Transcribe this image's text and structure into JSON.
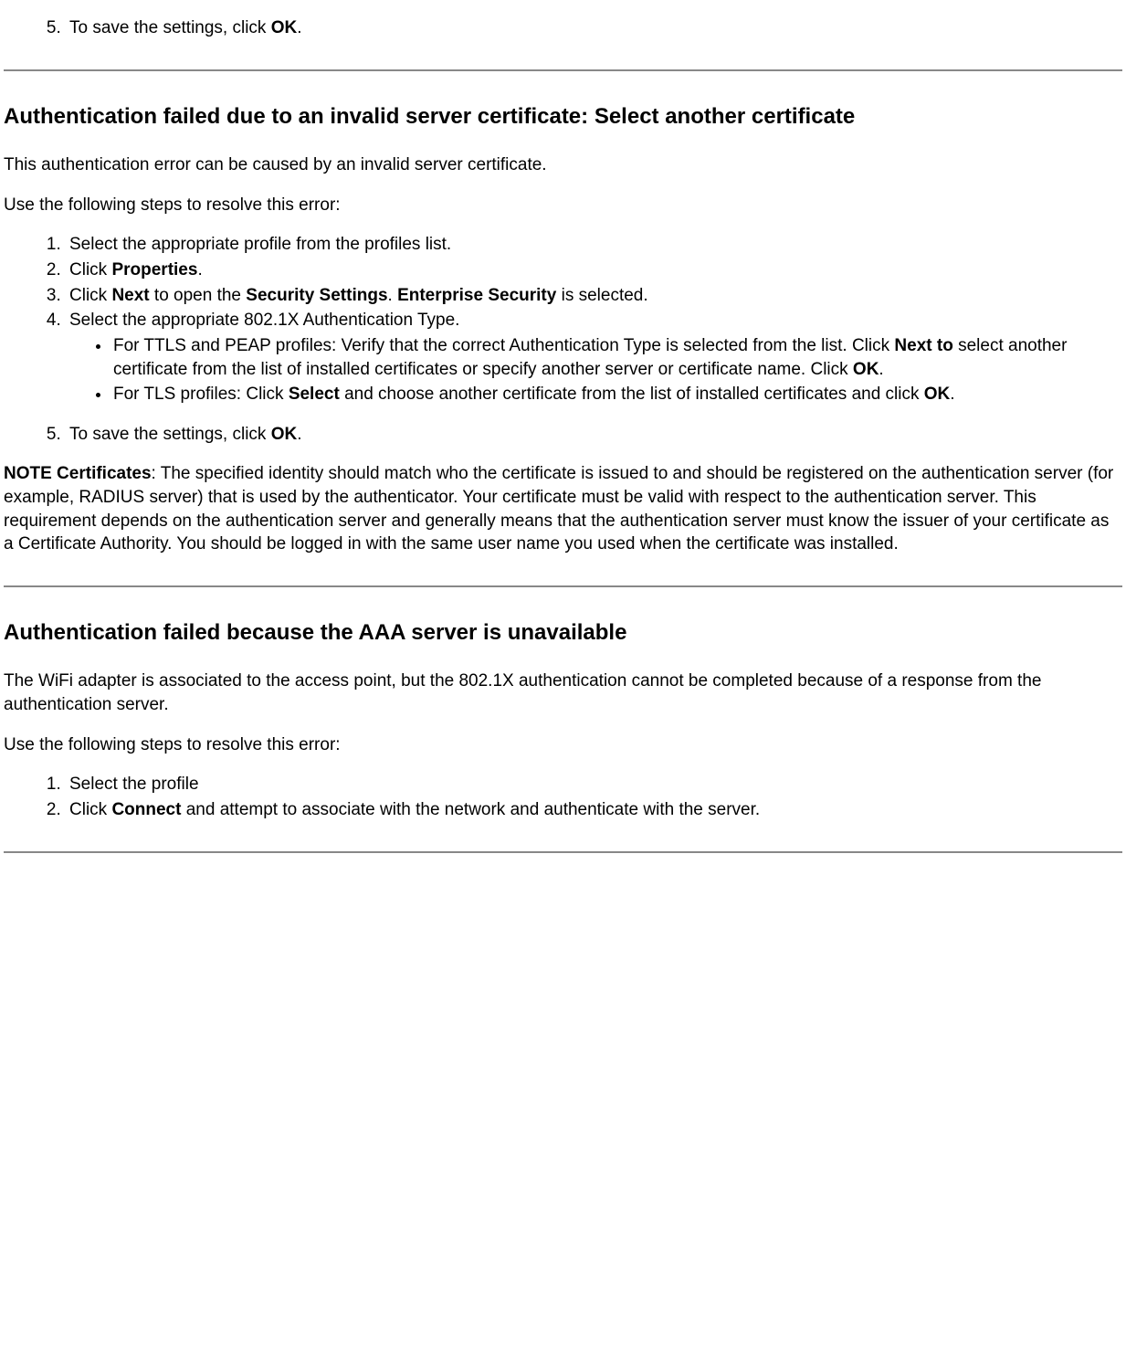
{
  "intro_step5": {
    "num": "5.",
    "pre": "To save the settings, click ",
    "b1": "OK",
    "post": "."
  },
  "sec1": {
    "heading": "Authentication failed due to an invalid server certificate: Select another certificate",
    "p1": "This authentication error can be caused by an invalid server certificate.",
    "p2": "Use the following steps to resolve this error:",
    "li1": "Select the appropriate profile from the profiles list.",
    "li2": {
      "pre": "Click ",
      "b": "Properties",
      "post": "."
    },
    "li3": {
      "t1": "Click ",
      "b1": "Next",
      "t2": " to open the ",
      "b2": "Security Settings",
      "t3": ". ",
      "b3": "Enterprise Security",
      "t4": " is selected."
    },
    "li4": "Select the appropriate 802.1X Authentication Type.",
    "sub1": {
      "t1": "For TTLS and PEAP profiles: Verify that the correct Authentication Type is selected from the list. Click ",
      "b1": "Next to",
      "t2": " select another certificate from the list of installed certificates or specify another server or certificate name. Click ",
      "b2": "OK",
      "t3": "."
    },
    "sub2": {
      "t1": "For TLS profiles: Click ",
      "b1": "Select",
      "t2": " and choose another certificate from the list of installed certificates and click ",
      "b2": "OK",
      "t3": "."
    },
    "li5": {
      "pre": "To save the settings, click ",
      "b": "OK",
      "post": "."
    },
    "note": {
      "b": "NOTE Certificates",
      "text": ": The specified identity should match who the certificate is issued to and should be registered on the authentication server (for example, RADIUS server) that is used by the authenticator. Your certificate must be valid with respect to the authentication server. This requirement depends on the authentication server and generally means that the authentication server must know the issuer of your certificate as a Certificate Authority. You should be logged in with the same user name you used when the certificate was installed."
    }
  },
  "sec2": {
    "heading": "Authentication failed because the AAA server is unavailable",
    "p1": "The WiFi adapter is associated to the access point, but the 802.1X authentication cannot be completed because of a response from the authentication server.",
    "p2": "Use the following steps to resolve this error:",
    "li1": "Select the profile",
    "li2": {
      "t1": "Click ",
      "b": "Connect",
      "t2": " and attempt to associate with the network and authenticate with the server."
    }
  }
}
